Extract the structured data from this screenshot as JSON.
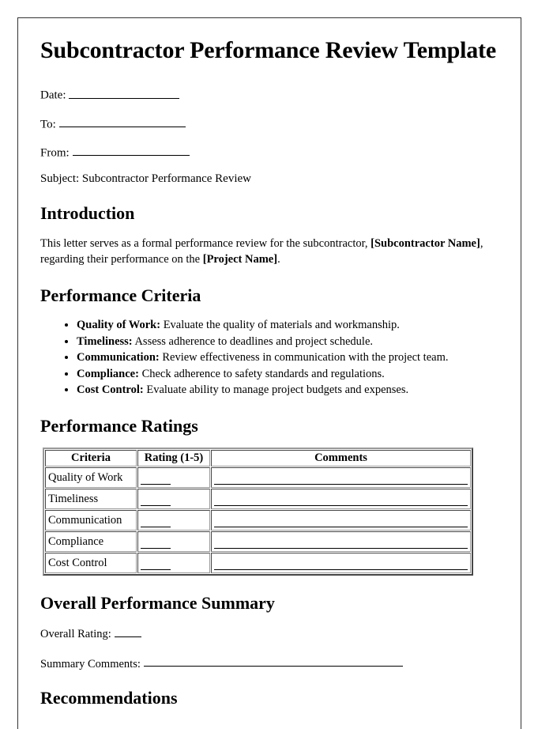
{
  "document": {
    "title": "Subcontractor Performance Review Template",
    "header_fields": [
      {
        "label": "Date:",
        "value": ""
      },
      {
        "label": "To:",
        "value": ""
      },
      {
        "label": "From:",
        "value": ""
      }
    ],
    "subject": "Subject: Subcontractor Performance Review",
    "introduction": {
      "heading": "Introduction",
      "text_part1": "This letter serves as a formal performance review for the subcontractor, ",
      "placeholder1": "[Subcontractor Name]",
      "text_part2": ", regarding their performance on the ",
      "placeholder2": "[Project Name]",
      "text_part3": "."
    },
    "performance_criteria": {
      "heading": "Performance Criteria",
      "items": [
        {
          "term": "Quality of Work:",
          "description": " Evaluate the quality of materials and workmanship."
        },
        {
          "term": "Timeliness:",
          "description": " Assess adherence to deadlines and project schedule."
        },
        {
          "term": "Communication:",
          "description": " Review effectiveness in communication with the project team."
        },
        {
          "term": "Compliance:",
          "description": " Check adherence to safety standards and regulations."
        },
        {
          "term": "Cost Control:",
          "description": " Evaluate ability to manage project budgets and expenses."
        }
      ]
    },
    "performance_ratings": {
      "heading": "Performance Ratings",
      "columns": [
        "Criteria",
        "Rating (1-5)",
        "Comments"
      ],
      "rows": [
        {
          "criteria": "Quality of Work",
          "rating": "",
          "comments": ""
        },
        {
          "criteria": "Timeliness",
          "rating": "",
          "comments": ""
        },
        {
          "criteria": "Communication",
          "rating": "",
          "comments": ""
        },
        {
          "criteria": "Compliance",
          "rating": "",
          "comments": ""
        },
        {
          "criteria": "Cost Control",
          "rating": "",
          "comments": ""
        }
      ]
    },
    "overall_summary": {
      "heading": "Overall Performance Summary",
      "overall_rating_label": "Overall Rating:",
      "overall_rating_value": "",
      "summary_comments_label": "Summary Comments:",
      "summary_comments_value": ""
    },
    "recommendations": {
      "heading": "Recommendations"
    }
  }
}
